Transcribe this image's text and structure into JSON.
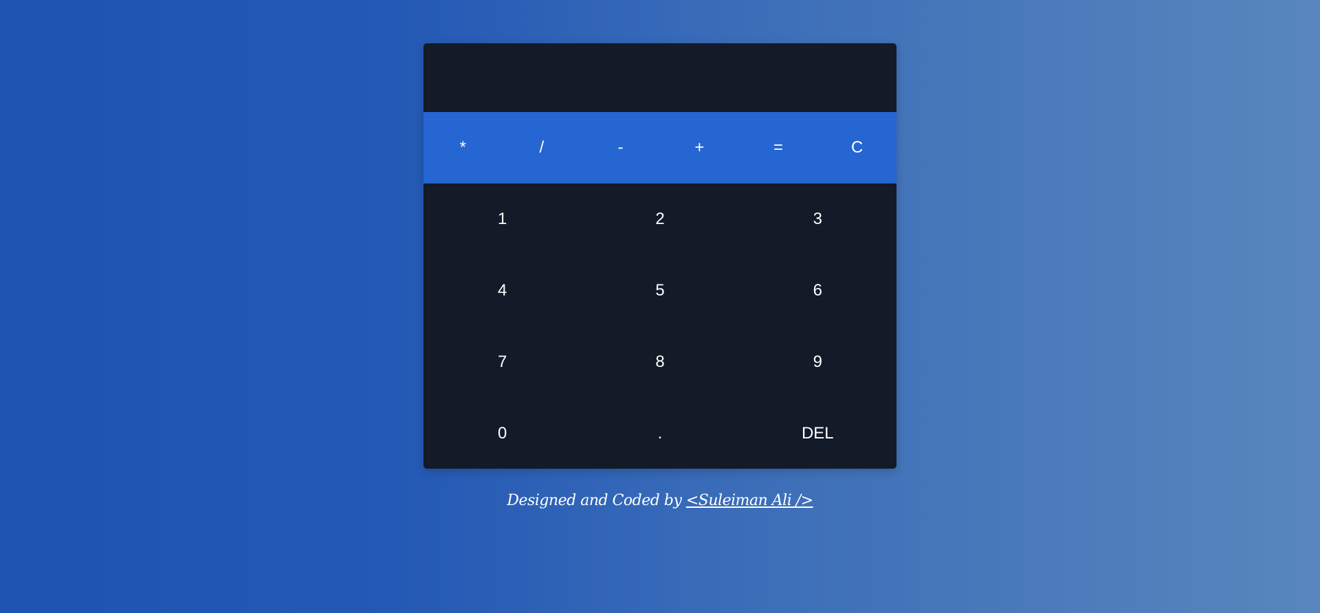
{
  "display": {
    "value": ""
  },
  "operators": [
    "*",
    "/",
    "-",
    "+",
    "=",
    "C"
  ],
  "digits": [
    "1",
    "2",
    "3",
    "4",
    "5",
    "6",
    "7",
    "8",
    "9",
    "0",
    ".",
    "DEL"
  ],
  "footer": {
    "text": "Designed and Coded by ",
    "author_link": "<Suleiman Ali />"
  },
  "colors": {
    "calculator_bg": "#131a28",
    "operator_bar": "#2566d2",
    "page_gradient_start": "#1f53b2",
    "page_gradient_end": "#5886bd",
    "text": "#ffffff"
  }
}
